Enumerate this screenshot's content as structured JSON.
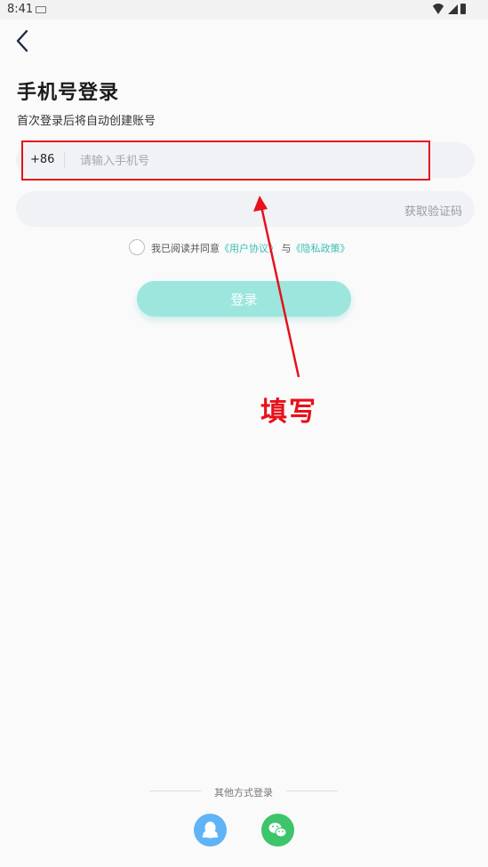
{
  "status_bar": {
    "time": "8:41",
    "icons": [
      "keyboard-icon",
      "wifi-icon",
      "signal-icon",
      "battery-icon"
    ]
  },
  "nav": {
    "back_icon": "chevron-left-icon"
  },
  "header": {
    "title": "手机号登录",
    "subtitle": "首次登录后将自动创建账号"
  },
  "phone": {
    "country_code": "+86",
    "placeholder": "请输入手机号",
    "value": ""
  },
  "code": {
    "placeholder": "",
    "value": "",
    "get_code_label": "获取验证码"
  },
  "agreement": {
    "prefix": "我已阅读并同意",
    "user_agreement": "《用户协议》",
    "connector": "与",
    "privacy_policy": "《隐私政策》",
    "checked": false
  },
  "login_button": {
    "label": "登录"
  },
  "annotation": {
    "label": "填写",
    "color": "#e8101a"
  },
  "other_login": {
    "label": "其他方式登录",
    "methods": [
      "qq-icon",
      "wechat-icon"
    ]
  },
  "colors": {
    "accent": "#3bbfb0",
    "button_bg": "#9ce6de",
    "qq": "#60b3f5",
    "wechat": "#3ec46a"
  }
}
